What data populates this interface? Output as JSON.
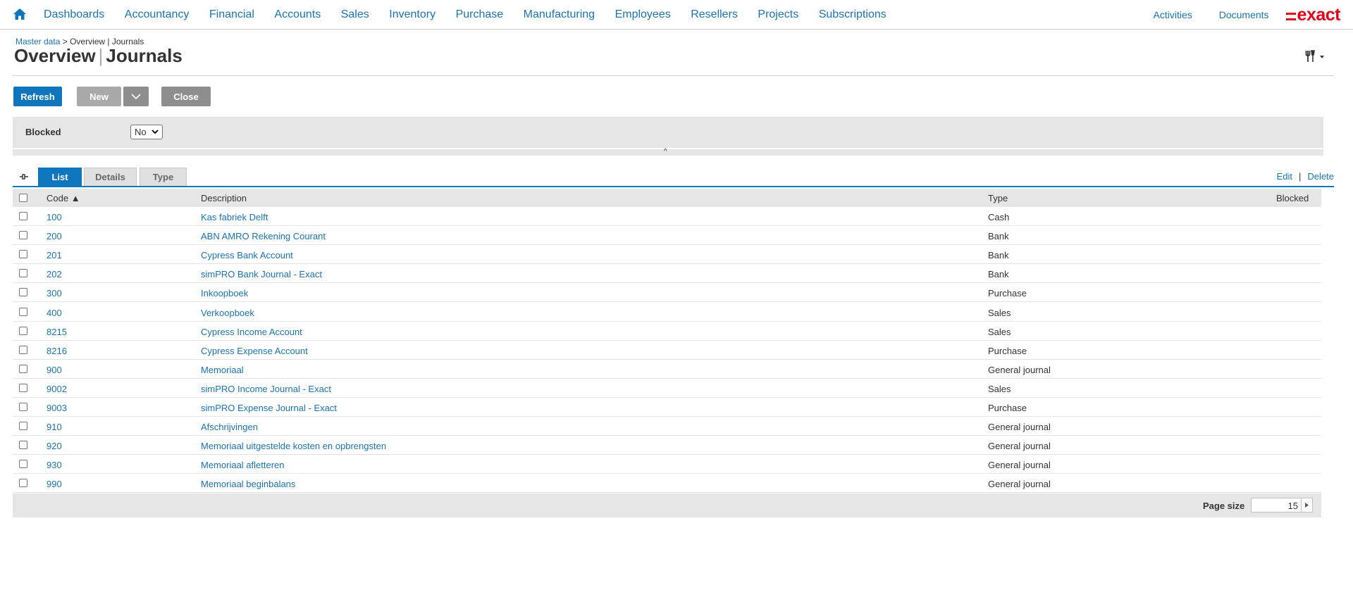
{
  "nav": {
    "items": [
      "Dashboards",
      "Accountancy",
      "Financial",
      "Accounts",
      "Sales",
      "Inventory",
      "Purchase",
      "Manufacturing",
      "Employees",
      "Resellers",
      "Projects",
      "Subscriptions"
    ],
    "right_items": [
      "Activities",
      "Documents"
    ],
    "logo_text": "exact",
    "home_icon": "home-icon"
  },
  "breadcrumb": {
    "root": "Master data",
    "sep": ">",
    "current": "Overview | Journals"
  },
  "title": {
    "main": "Overview",
    "sep": "|",
    "sub": "Journals"
  },
  "toolbar": {
    "refresh": "Refresh",
    "new": "New",
    "close": "Close",
    "tools_icon": "tools-icon"
  },
  "filter": {
    "label": "Blocked",
    "value": "No"
  },
  "tabs": {
    "list": "List",
    "details": "Details",
    "type": "Type",
    "active": "List"
  },
  "actions": {
    "edit": "Edit",
    "sep": "|",
    "delete": "Delete"
  },
  "table": {
    "headers": {
      "code": "Code ▲",
      "description": "Description",
      "type": "Type",
      "blocked": "Blocked"
    },
    "rows": [
      {
        "code": "100",
        "description": "Kas fabriek Delft",
        "type": "Cash"
      },
      {
        "code": "200",
        "description": "ABN AMRO Rekening Courant",
        "type": "Bank"
      },
      {
        "code": "201",
        "description": "Cypress Bank Account",
        "type": "Bank"
      },
      {
        "code": "202",
        "description": "simPRO Bank Journal - Exact",
        "type": "Bank"
      },
      {
        "code": "300",
        "description": "Inkoopboek",
        "type": "Purchase"
      },
      {
        "code": "400",
        "description": "Verkoopboek",
        "type": "Sales"
      },
      {
        "code": "8215",
        "description": "Cypress Income Account",
        "type": "Sales"
      },
      {
        "code": "8216",
        "description": "Cypress Expense Account",
        "type": "Purchase"
      },
      {
        "code": "900",
        "description": "Memoriaal",
        "type": "General journal"
      },
      {
        "code": "9002",
        "description": "simPRO Income Journal - Exact",
        "type": "Sales"
      },
      {
        "code": "9003",
        "description": "simPRO Expense Journal - Exact",
        "type": "Purchase"
      },
      {
        "code": "910",
        "description": "Afschrijvingen",
        "type": "General journal"
      },
      {
        "code": "920",
        "description": "Memoriaal uitgestelde kosten en opbrengsten",
        "type": "General journal"
      },
      {
        "code": "930",
        "description": "Memoriaal afletteren",
        "type": "General journal"
      },
      {
        "code": "990",
        "description": "Memoriaal beginbalans",
        "type": "General journal"
      }
    ]
  },
  "pager": {
    "label": "Page size",
    "value": "15"
  },
  "colors": {
    "accent": "#0f75bc",
    "link": "#1a73b5",
    "brand": "#e2001a"
  }
}
